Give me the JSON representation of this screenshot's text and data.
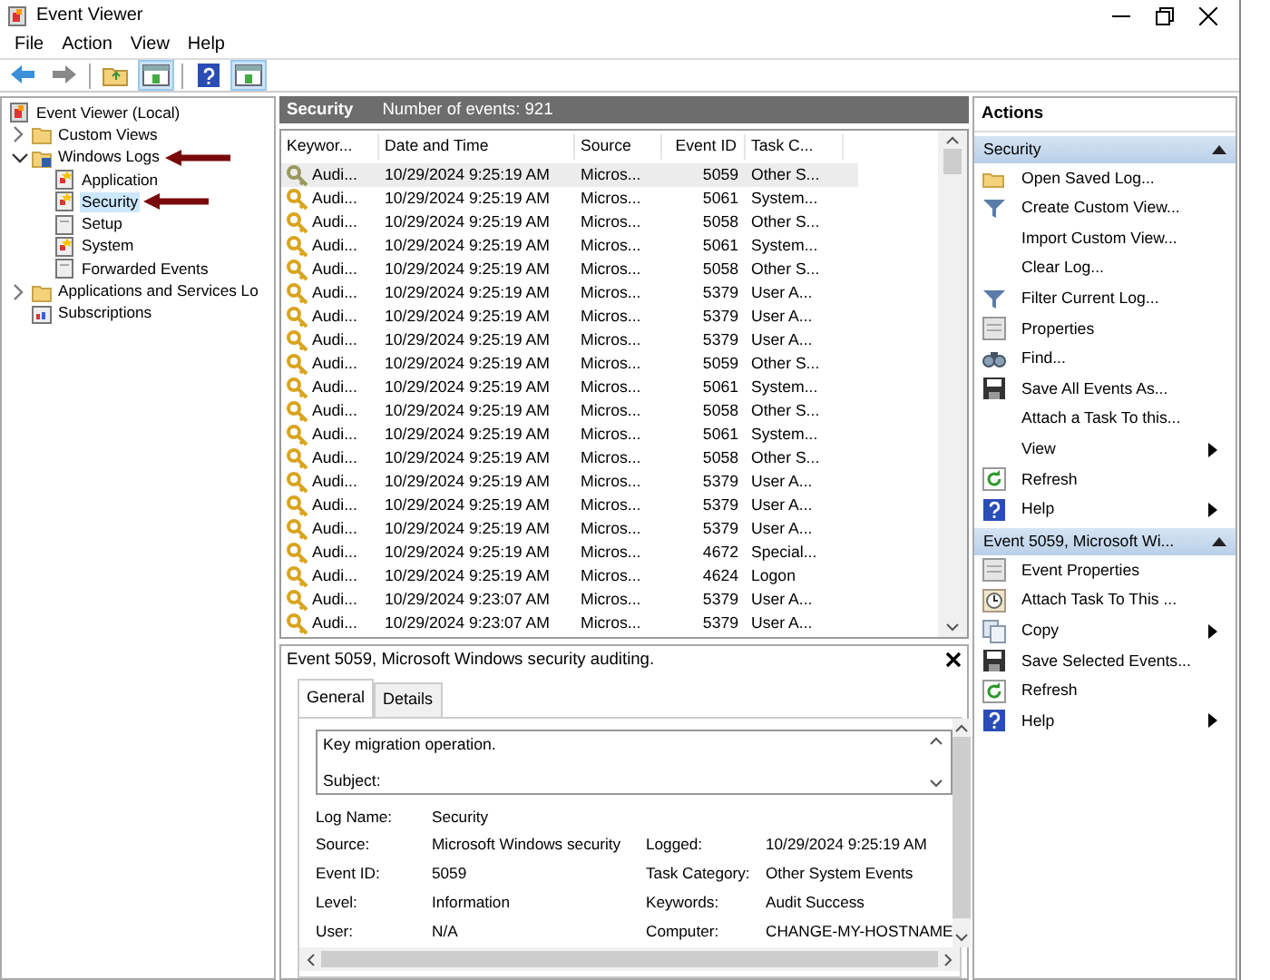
{
  "window": {
    "title": "Event Viewer"
  },
  "menu": [
    "File",
    "Action",
    "View",
    "Help"
  ],
  "toolbar": [
    {
      "kind": "back",
      "pressed": false
    },
    {
      "kind": "forward",
      "pressed": false
    },
    {
      "kind": "sep"
    },
    {
      "kind": "folder",
      "pressed": false
    },
    {
      "kind": "pane",
      "pressed": true
    },
    {
      "kind": "sep"
    },
    {
      "kind": "help",
      "pressed": false
    },
    {
      "kind": "pane",
      "pressed": true
    }
  ],
  "tree": [
    {
      "label": "Event Viewer (Local)",
      "kind": "viewer",
      "selected": false,
      "children": [
        {
          "label": "Custom Views",
          "kind": "folder",
          "expanded": false,
          "selected": false
        },
        {
          "label": "Windows Logs",
          "kind": "logfolder",
          "expanded": true,
          "selected": false,
          "annotated": true,
          "children": [
            {
              "label": "Application",
              "kind": "log",
              "selected": false
            },
            {
              "label": "Security",
              "kind": "log",
              "selected": true,
              "annotated": true
            },
            {
              "label": "Setup",
              "kind": "plainlog",
              "selected": false
            },
            {
              "label": "System",
              "kind": "log",
              "selected": false
            },
            {
              "label": "Forwarded Events",
              "kind": "plainlog",
              "selected": false
            }
          ]
        },
        {
          "label": "Applications and Services Lo",
          "kind": "folder",
          "expanded": false,
          "selected": false
        },
        {
          "label": "Subscriptions",
          "kind": "subs",
          "selected": false
        }
      ]
    }
  ],
  "log_header": {
    "title": "Security",
    "count": "Number of events: 921"
  },
  "table": {
    "columns": [
      "Keywor...",
      "Date and Time",
      "Source",
      "Event ID",
      "Task C..."
    ],
    "rows": [
      {
        "selected": true,
        "cells": [
          "Audi...",
          "10/29/2024 9:25:19 AM",
          "Micros...",
          "5059",
          "Other S..."
        ]
      },
      {
        "selected": false,
        "cells": [
          "Audi...",
          "10/29/2024 9:25:19 AM",
          "Micros...",
          "5061",
          "System..."
        ]
      },
      {
        "selected": false,
        "cells": [
          "Audi...",
          "10/29/2024 9:25:19 AM",
          "Micros...",
          "5058",
          "Other S..."
        ]
      },
      {
        "selected": false,
        "cells": [
          "Audi...",
          "10/29/2024 9:25:19 AM",
          "Micros...",
          "5061",
          "System..."
        ]
      },
      {
        "selected": false,
        "cells": [
          "Audi...",
          "10/29/2024 9:25:19 AM",
          "Micros...",
          "5058",
          "Other S..."
        ]
      },
      {
        "selected": false,
        "cells": [
          "Audi...",
          "10/29/2024 9:25:19 AM",
          "Micros...",
          "5379",
          "User A..."
        ]
      },
      {
        "selected": false,
        "cells": [
          "Audi...",
          "10/29/2024 9:25:19 AM",
          "Micros...",
          "5379",
          "User A..."
        ]
      },
      {
        "selected": false,
        "cells": [
          "Audi...",
          "10/29/2024 9:25:19 AM",
          "Micros...",
          "5379",
          "User A..."
        ]
      },
      {
        "selected": false,
        "cells": [
          "Audi...",
          "10/29/2024 9:25:19 AM",
          "Micros...",
          "5059",
          "Other S..."
        ]
      },
      {
        "selected": false,
        "cells": [
          "Audi...",
          "10/29/2024 9:25:19 AM",
          "Micros...",
          "5061",
          "System..."
        ]
      },
      {
        "selected": false,
        "cells": [
          "Audi...",
          "10/29/2024 9:25:19 AM",
          "Micros...",
          "5058",
          "Other S..."
        ]
      },
      {
        "selected": false,
        "cells": [
          "Audi...",
          "10/29/2024 9:25:19 AM",
          "Micros...",
          "5061",
          "System..."
        ]
      },
      {
        "selected": false,
        "cells": [
          "Audi...",
          "10/29/2024 9:25:19 AM",
          "Micros...",
          "5058",
          "Other S..."
        ]
      },
      {
        "selected": false,
        "cells": [
          "Audi...",
          "10/29/2024 9:25:19 AM",
          "Micros...",
          "5379",
          "User A..."
        ]
      },
      {
        "selected": false,
        "cells": [
          "Audi...",
          "10/29/2024 9:25:19 AM",
          "Micros...",
          "5379",
          "User A..."
        ]
      },
      {
        "selected": false,
        "cells": [
          "Audi...",
          "10/29/2024 9:25:19 AM",
          "Micros...",
          "5379",
          "User A..."
        ]
      },
      {
        "selected": false,
        "cells": [
          "Audi...",
          "10/29/2024 9:25:19 AM",
          "Micros...",
          "4672",
          "Special..."
        ]
      },
      {
        "selected": false,
        "cells": [
          "Audi...",
          "10/29/2024 9:25:19 AM",
          "Micros...",
          "4624",
          "Logon"
        ]
      },
      {
        "selected": false,
        "cells": [
          "Audi...",
          "10/29/2024 9:23:07 AM",
          "Micros...",
          "5379",
          "User A..."
        ]
      },
      {
        "selected": false,
        "cells": [
          "Audi...",
          "10/29/2024 9:23:07 AM",
          "Micros...",
          "5379",
          "User A..."
        ]
      }
    ]
  },
  "detail": {
    "title": "Event 5059, Microsoft Windows security auditing.",
    "tabs": [
      {
        "label": "General",
        "selected": true
      },
      {
        "label": "Details",
        "selected": false
      }
    ],
    "description": [
      "Key migration operation.",
      "Subject:"
    ],
    "fields": [
      {
        "label": "Log Name:",
        "value": "Security"
      },
      {
        "label": "Source:",
        "value": "Microsoft Windows security",
        "label2": "Logged:",
        "value2": "10/29/2024 9:25:19 AM"
      },
      {
        "label": "Event ID:",
        "value": "5059",
        "label2": "Task Category:",
        "value2": "Other System Events"
      },
      {
        "label": "Level:",
        "value": "Information",
        "label2": "Keywords:",
        "value2": "Audit Success"
      },
      {
        "label": "User:",
        "value": "N/A",
        "label2": "Computer:",
        "value2": "CHANGE-MY-HOSTNAME"
      }
    ]
  },
  "actions": {
    "title": "Actions",
    "sections": [
      {
        "title": "Security",
        "items": [
          {
            "label": "Open Saved Log...",
            "kind": "open",
            "submenu": false
          },
          {
            "label": "Create Custom View...",
            "kind": "filter",
            "submenu": false
          },
          {
            "label": "Import Custom View...",
            "kind": "none",
            "submenu": false
          },
          {
            "label": "Clear Log...",
            "kind": "none",
            "submenu": false
          },
          {
            "label": "Filter Current Log...",
            "kind": "filter",
            "submenu": false
          },
          {
            "label": "Properties",
            "kind": "props",
            "submenu": false
          },
          {
            "label": "Find...",
            "kind": "find",
            "submenu": false
          },
          {
            "label": "Save All Events As...",
            "kind": "save",
            "submenu": false
          },
          {
            "label": "Attach a Task To this...",
            "kind": "none",
            "submenu": false
          },
          {
            "label": "View",
            "kind": "none",
            "submenu": true
          },
          {
            "label": "Refresh",
            "kind": "refresh",
            "submenu": false
          },
          {
            "label": "Help",
            "kind": "help",
            "submenu": true
          }
        ]
      },
      {
        "title": "Event 5059, Microsoft Wi...",
        "items": [
          {
            "label": "Event Properties",
            "kind": "props",
            "submenu": false
          },
          {
            "label": "Attach Task To This ...",
            "kind": "task",
            "submenu": false
          },
          {
            "label": "Copy",
            "kind": "copy",
            "submenu": true
          },
          {
            "label": "Save Selected Events...",
            "kind": "save",
            "submenu": false
          },
          {
            "label": "Refresh",
            "kind": "refresh",
            "submenu": false
          },
          {
            "label": "Help",
            "kind": "help",
            "submenu": true
          }
        ]
      }
    ]
  }
}
